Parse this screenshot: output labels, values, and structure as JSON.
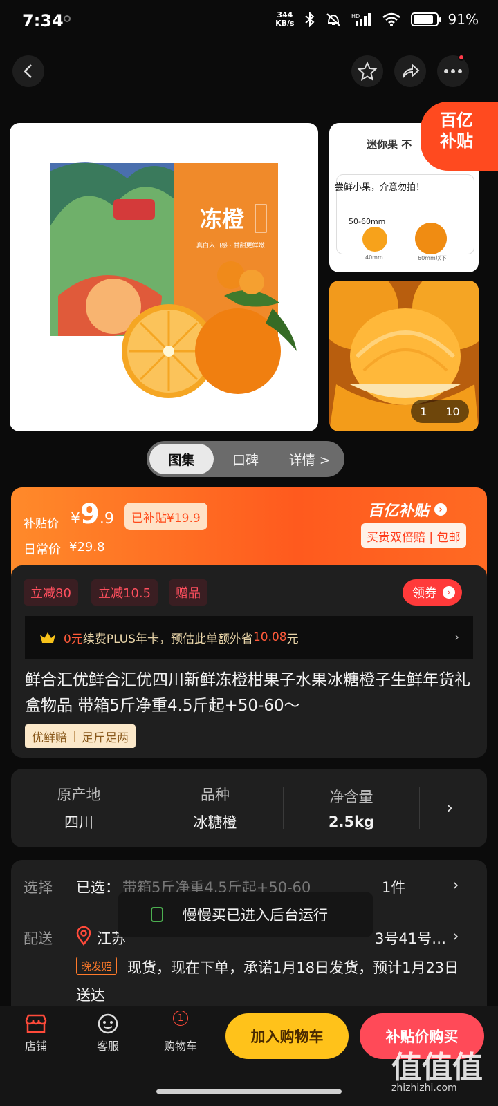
{
  "status": {
    "time": "7:34",
    "speed_top": "344",
    "speed_bottom": "KB/s",
    "battery": "91%"
  },
  "gallery": {
    "main_title": "冻橙",
    "main_seal": "冻橙",
    "main_subtitle": "真白入口感 · 甘甜更鲜嫩",
    "side_top_title": "迷你果 不",
    "side_top_note": "尝鲜小果，介意勿拍！",
    "side_top_size": "50-60mm",
    "side_top_l1": "40mm",
    "side_top_l2": "60mm以下",
    "counter_current": "1",
    "counter_total": "10",
    "badge": "百亿补贴"
  },
  "tabs": [
    {
      "label": "图集"
    },
    {
      "label": "口碑"
    },
    {
      "label": "详情 >"
    }
  ],
  "price": {
    "subsidy_label": "补贴价",
    "currency": "¥",
    "int": "9",
    "dec": ".9",
    "subsidized": "已补贴¥19.9",
    "daily_label": "日常价",
    "daily": "¥29.8",
    "brand": "百亿补贴",
    "guarantee": "买贵双倍赔 | 包邮"
  },
  "promos": [
    "立减80",
    "立减10.5",
    "赠品"
  ],
  "coupon_btn": "领券",
  "plus": {
    "pre": "0元",
    "mid": "续费PLUS年卡，预估此单额外省",
    "amount": "10.08",
    "unit": "元"
  },
  "product_title": "鲜合汇优鲜合汇优四川新鲜冻橙柑果子水果冰糖橙子生鲜年货礼盒物品 带箱5斤净重4.5斤起+50-60～",
  "tags": [
    "优鲜赔",
    "足斤足两"
  ],
  "spec": [
    {
      "k": "原产地",
      "v": "四川"
    },
    {
      "k": "品种",
      "v": "冰糖橙"
    },
    {
      "k": "净含量",
      "v": "2.5kg"
    }
  ],
  "select": {
    "label": "选择",
    "value_prefix": "已选：",
    "value_faded": "带箱5斤净重4.5斤起+50-60",
    "qty": "1件",
    "ship_label": "配送",
    "addr_start": "江苏",
    "addr_end": "3号41号…",
    "late_tag": "晚发赔",
    "ship_text": "现货，现在下单，承诺1月18日发货，预计1月23日送达"
  },
  "toast": "慢慢买已进入后台运行",
  "bottom": {
    "shop": "店铺",
    "service": "客服",
    "cart": "购物车",
    "cart_count": "1",
    "add_cart": "加入购物车",
    "buy": "补贴价购买",
    "watermark": "值值值",
    "watermark_url": "zhizhizhi.com"
  }
}
